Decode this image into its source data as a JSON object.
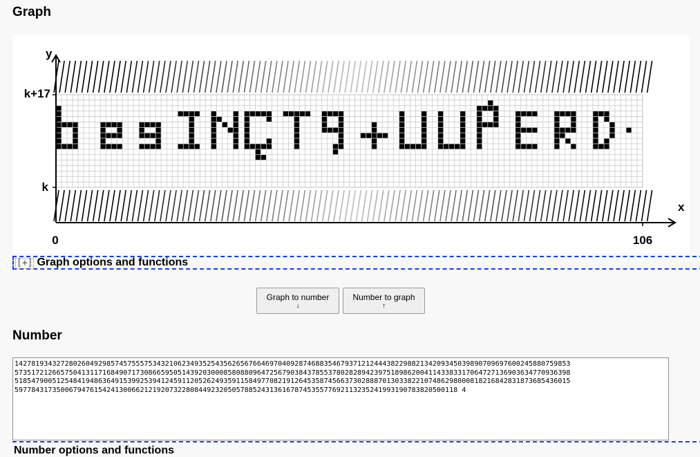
{
  "graph_section": {
    "heading": "Graph",
    "y_axis_label": "y",
    "x_axis_label": "x",
    "y_top_label": "k+17",
    "y_bottom_label": "k",
    "x_start_label": "0",
    "x_end_label": "106",
    "plotted_text": "bEgINCTQTUUPERD",
    "plot_columns": 106,
    "plot_rows": 17
  },
  "options_bar": {
    "toggle": "[+]",
    "label": "Graph options and functions"
  },
  "buttons": {
    "graph_to_number": "Graph to number",
    "graph_to_number_arrow": "↓",
    "number_to_graph": "Number to graph",
    "number_to_graph_arrow": "↑"
  },
  "number_section": {
    "heading": "Number",
    "value": "1427819343272802604929857457555753432106234935254356265676646970409287468835467937121244438229882134209345039890709697600245880759853573517212665750413117168490717308665950514392030008580880964725679038437855378028289423975189862004114338331706472713690363477093639851854790051254841948636491539925394124591120526249359115849770821912645358745663730288870130338221074862980008182168428318736854360155977843173500679476154241300662121920732280844923205057885243136167874535577692113235241993190783820500118",
    "lines": [
      "1427819343272802604929857457555753432106234935254356265676646970409287468835467937121244438229882134209345039890709697600245880759853",
      "5735172126657504131171684907173086659505143920300085808809647256790384378553780282894239751898620041143383317064727136903634770936398",
      "5185479005125484194863649153992539412459112052624935911584977082191264535874566373028887013033822107486298000818216842831873685436015",
      "5977843173500679476154241300662121920732280844923205057885243136167874535577692113235241993190783820500118 4"
    ]
  },
  "bottom_bar": {
    "label": "Number options and functions"
  }
}
